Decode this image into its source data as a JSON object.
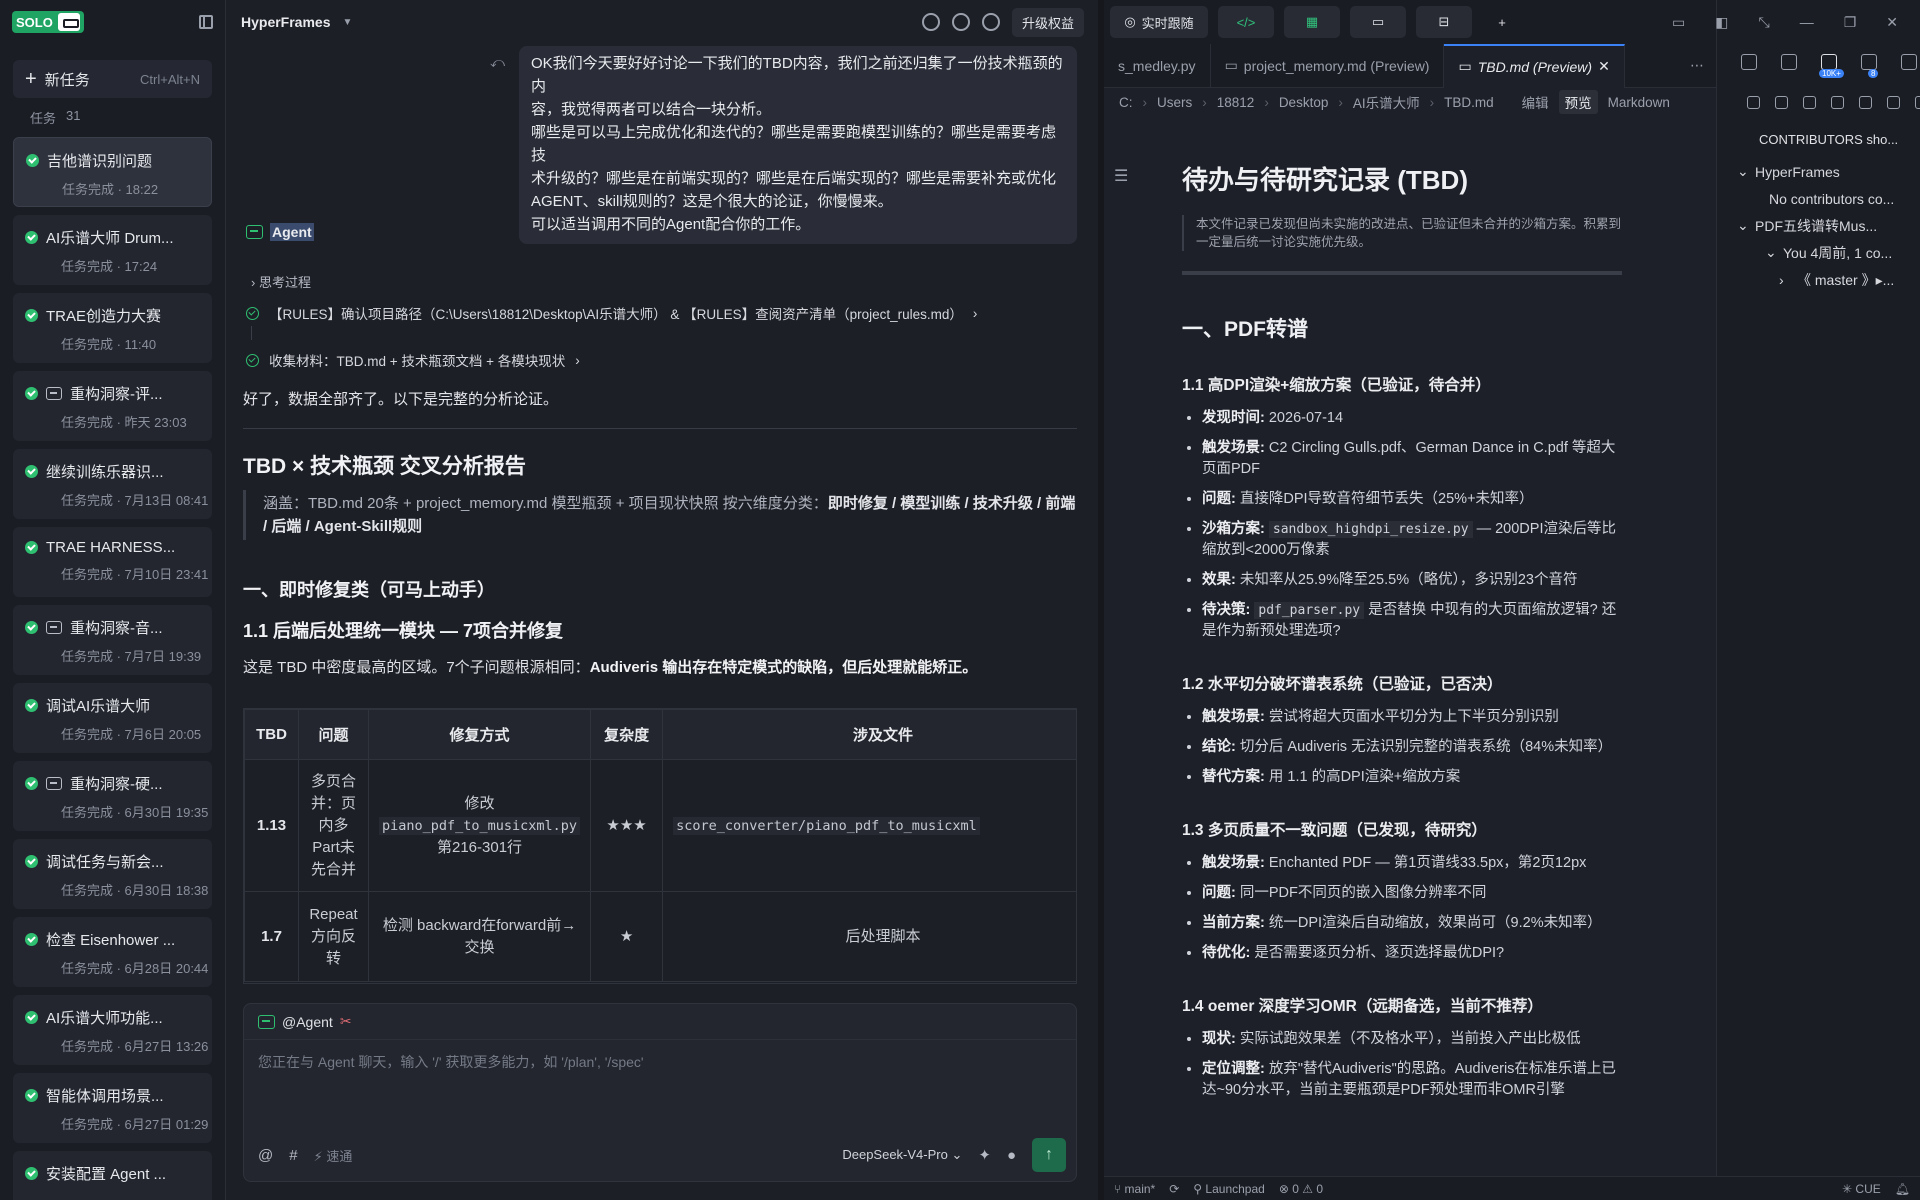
{
  "sidebar": {
    "logo_text": "SOLO",
    "new_task": "新任务",
    "new_task_shortcut": "Ctrl+Alt+N",
    "tasks_label": "任务",
    "tasks_count": "31",
    "items": [
      {
        "title": "吉他谱识别问题",
        "sub": "任务完成 · 18:22",
        "icon": "ok"
      },
      {
        "title": "AI乐谱大师 Drum...",
        "sub": "任务完成 · 17:24",
        "icon": "ok"
      },
      {
        "title": "TRAE创造力大赛",
        "sub": "任务完成 · 11:40",
        "icon": "ok"
      },
      {
        "title": "重构洞察-评...",
        "sub": "任务完成 · 昨天 23:03",
        "icon": "bot"
      },
      {
        "title": "继续训练乐器识...",
        "sub": "任务完成 · 7月13日 08:41",
        "icon": "ok"
      },
      {
        "title": "TRAE HARNESS...",
        "sub": "任务完成 · 7月10日 23:41",
        "icon": "ok"
      },
      {
        "title": "重构洞察-音...",
        "sub": "任务完成 · 7月7日 19:39",
        "icon": "bot"
      },
      {
        "title": "调试AI乐谱大师",
        "sub": "任务完成 · 7月6日 20:05",
        "icon": "ok"
      },
      {
        "title": "重构洞察-硬...",
        "sub": "任务完成 · 6月30日 19:35",
        "icon": "bot"
      },
      {
        "title": "调试任务与新会...",
        "sub": "任务完成 · 6月30日 18:38",
        "icon": "ok"
      },
      {
        "title": "检查 Eisenhower ...",
        "sub": "任务完成 · 6月28日 20:44",
        "icon": "ok"
      },
      {
        "title": "AI乐谱大师功能...",
        "sub": "任务完成 · 6月27日 13:26",
        "icon": "ok"
      },
      {
        "title": "智能体调用场景...",
        "sub": "任务完成 · 6月27日 01:29",
        "icon": "ok"
      },
      {
        "title": "安装配置 Agent ...",
        "sub": "",
        "icon": "ok"
      }
    ]
  },
  "chat": {
    "project": "HyperFrames",
    "upgrade": "升级权益",
    "user_message": [
      "OK我们今天要好好讨论一下我们的TBD内容，我们之前还归集了一份技术瓶颈的内",
      "容，我觉得两者可以结合一块分析。",
      "哪些是可以马上完成优化和迭代的？哪些是需要跑模型训练的？哪些是需要考虑技",
      "术升级的？哪些是在前端实现的？哪些是在后端实现的？哪些是需要补充或优化",
      "AGENT、skill规则的？这是个很大的论证，你慢慢来。",
      "可以适当调用不同的Agent配合你的工作。"
    ],
    "agent_name": "Agent",
    "thinking": "思考过程",
    "step1": "【RULES】确认项目路径（C:\\Users\\18812\\Desktop\\AI乐谱大师） & 【RULES】查阅资产清单（project_rules.md）",
    "step2": "收集材料：TBD.md + 技术瓶颈文档 + 各模块现状",
    "ready": "好了，数据全部齐了。以下是完整的分析论证。",
    "report_title": "TBD × 技术瓶颈 交叉分析报告",
    "quote_plain": "涵盖：TBD.md 20条 + project_memory.md 模型瓶颈 + 项目现状快照 按六维度分类：",
    "quote_bold": "即时修复 / 模型训练 / 技术升级 / 前端 / 后端 / Agent-Skill规则",
    "section1": "一、即时修复类（可马上动手）",
    "sub11": "1.1 后端后处理统一模块 — 7项合并修复",
    "para_plain": "这是 TBD 中密度最高的区域。7个子问题根源相同：",
    "para_bold": "Audiveris 输出存在特定模式的缺陷，但后处理就能矫正。",
    "table": {
      "headers": [
        "TBD",
        "问题",
        "修复方式",
        "复杂度",
        "涉及文件"
      ],
      "rows": [
        {
          "tbd": "1.13",
          "problem": "多页合并：页内多Part未先合并",
          "fix_pre": "修改",
          "fix_code": "piano_pdf_to_musicxml.py",
          "fix_post": "第216-301行",
          "stars": "★★★",
          "file_code": "score_converter/piano_pdf_to_musicxml"
        },
        {
          "tbd": "1.7",
          "problem": "Repeat方向反转",
          "fix_pre": "检测 backward在forward前→交换",
          "fix_code": "",
          "fix_post": "",
          "stars": "★",
          "file_code": "后处理脚本"
        }
      ]
    },
    "composer_mention": "@Agent",
    "composer_placeholder": "您正在与 Agent 聊天，输入 '/' 获取更多能力，如 '/plan', '/spec'",
    "speed": "速通",
    "model": "DeepSeek-V4-Pro"
  },
  "editor": {
    "pill_realtime": "实时跟随",
    "tabs": [
      "s_medley.py",
      "project_memory.md (Preview)",
      "TBD.md (Preview)"
    ],
    "crumbs": [
      "C:",
      "Users",
      "18812",
      "Desktop",
      "AI乐谱大师",
      "TBD.md"
    ],
    "modes": [
      "编辑",
      "预览",
      "Markdown"
    ],
    "doc": {
      "title": "待办与待研究记录 (TBD)",
      "quote": "本文件记录已发现但尚未实施的改进点、已验证但未合并的沙箱方案。积累到一定量后统一讨论实施优先级。",
      "h2": "一、PDF转谱",
      "s1": "1.1 高DPI渲染+缩放方案（已验证，待合并）",
      "s1_items": [
        {
          "k": "发现时间:",
          "v": " 2026-07-14"
        },
        {
          "k": "触发场景:",
          "v": " C2 Circling Gulls.pdf、German Dance in C.pdf 等超大页面PDF"
        },
        {
          "k": "问题:",
          "v": " 直接降DPI导致音符细节丢失（25%+未知率）"
        },
        {
          "k": "沙箱方案:",
          "v": " — 200DPI渲染后等比缩放到<2000万像素",
          "code": "sandbox_highdpi_resize.py"
        },
        {
          "k": "效果:",
          "v": " 未知率从25.9%降至25.5%（略优），多识别23个音符"
        },
        {
          "k": "待决策:",
          "v": " 是否替换 中现有的大页面缩放逻辑? 还是作为新预处理选项?",
          "code": "pdf_parser.py"
        }
      ],
      "s2": "1.2 水平切分破坏谱表系统（已验证，已否决）",
      "s2_items": [
        {
          "k": "触发场景:",
          "v": " 尝试将超大页面水平切分为上下半页分别识别"
        },
        {
          "k": "结论:",
          "v": " 切分后 Audiveris 无法识别完整的谱表系统（84%未知率）"
        },
        {
          "k": "替代方案:",
          "v": " 用 1.1 的高DPI渲染+缩放方案"
        }
      ],
      "s3": "1.3 多页质量不一致问题（已发现，待研究）",
      "s3_items": [
        {
          "k": "触发场景:",
          "v": " Enchanted PDF — 第1页谱线33.5px，第2页12px"
        },
        {
          "k": "问题:",
          "v": " 同一PDF不同页的嵌入图像分辨率不同"
        },
        {
          "k": "当前方案:",
          "v": " 统一DPI渲染后自动缩放，效果尚可（9.2%未知率）"
        },
        {
          "k": "待优化:",
          "v": " 是否需要逐页分析、逐页选择最优DPI?"
        }
      ],
      "s4": "1.4 oemer 深度学习OMR（远期备选，当前不推荐）",
      "s4_items": [
        {
          "k": "现状:",
          "v": " 实际试跑效果差（不及格水平），当前投入产出比极低"
        },
        {
          "k": "定位调整:",
          "v": " 放弃\"替代Audiveris\"的思路。Audiveris在标准乐谱上已达~90分水平，当前主要瓶颈是PDF预处理而非OMR引擎"
        }
      ]
    }
  },
  "right_panel": {
    "badge1": "10K+",
    "badge2": "8",
    "title": "CONTRIBUTORS sho...",
    "tree": [
      {
        "t": "HyperFrames",
        "indent": 0,
        "arrow": "⌄"
      },
      {
        "t": "No contributors co...",
        "indent": 1,
        "arrow": ""
      },
      {
        "t": "PDF五线谱转Mus...",
        "indent": 0,
        "arrow": "⌄"
      },
      {
        "t": "You  4周前, 1 co...",
        "indent": 2,
        "arrow": "⌄"
      },
      {
        "t": "《 master 》▸...",
        "indent": 3,
        "arrow": "›"
      }
    ]
  },
  "status": {
    "branch": "main*",
    "launchpad": "Launchpad",
    "errors": "0",
    "warnings": "0",
    "cue": "CUE"
  }
}
